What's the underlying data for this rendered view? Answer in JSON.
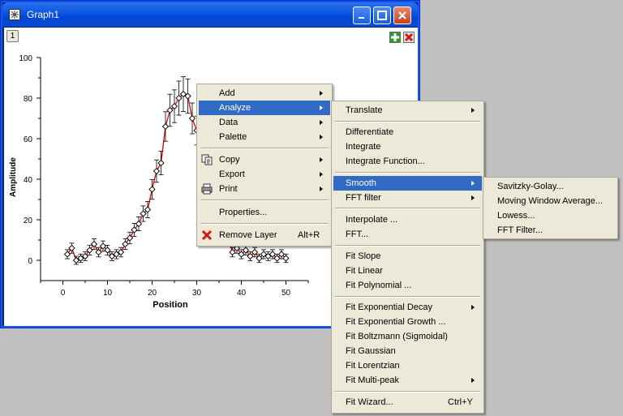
{
  "window": {
    "title": "Graph1",
    "layer_label": "1"
  },
  "plot": {
    "ylabel": "Amplitude",
    "xlabel": "Position",
    "xticks": [
      "0",
      "10",
      "20",
      "30",
      "40",
      "50"
    ],
    "yticks": [
      "0",
      "20",
      "40",
      "60",
      "80",
      "100"
    ]
  },
  "chart_data": {
    "type": "scatter",
    "xlabel": "Position",
    "ylabel": "Amplitude",
    "xlim": [
      -5,
      55
    ],
    "ylim": [
      -10,
      100
    ],
    "series": [
      {
        "points": [
          [
            1,
            3
          ],
          [
            2,
            6
          ],
          [
            3,
            0
          ],
          [
            4,
            1
          ],
          [
            5,
            2
          ],
          [
            6,
            5
          ],
          [
            7,
            8
          ],
          [
            8,
            4
          ],
          [
            9,
            7
          ],
          [
            10,
            5
          ],
          [
            11,
            2
          ],
          [
            12,
            3
          ],
          [
            13,
            4
          ],
          [
            14,
            8
          ],
          [
            15,
            11
          ],
          [
            16,
            15
          ],
          [
            17,
            18
          ],
          [
            18,
            23
          ],
          [
            19,
            25
          ],
          [
            20,
            35
          ],
          [
            21,
            44
          ],
          [
            22,
            48
          ],
          [
            23,
            66
          ],
          [
            24,
            74
          ],
          [
            25,
            76
          ],
          [
            26,
            80
          ],
          [
            27,
            82
          ],
          [
            28,
            81
          ],
          [
            29,
            70
          ],
          [
            30,
            64
          ],
          [
            31,
            58
          ],
          [
            38,
            4
          ],
          [
            39,
            6
          ],
          [
            40,
            3
          ],
          [
            41,
            5
          ],
          [
            42,
            2
          ],
          [
            43,
            4
          ],
          [
            44,
            1
          ],
          [
            45,
            3
          ],
          [
            46,
            2
          ],
          [
            47,
            3
          ],
          [
            48,
            1
          ],
          [
            49,
            3
          ],
          [
            50,
            1
          ]
        ]
      }
    ],
    "fit_color": "#e00000",
    "marker_color": "#000000"
  },
  "menu": {
    "items": [
      {
        "label": "Add"
      },
      {
        "label": "Analyze"
      },
      {
        "label": "Data"
      },
      {
        "label": "Palette"
      },
      {
        "label": "Copy"
      },
      {
        "label": "Export"
      },
      {
        "label": "Print"
      },
      {
        "label": "Properties..."
      },
      {
        "label": "Remove Layer",
        "shortcut": "Alt+R"
      }
    ]
  },
  "analyze_menu": {
    "items": [
      {
        "label": "Translate"
      },
      {
        "label": "Differentiate"
      },
      {
        "label": "Integrate"
      },
      {
        "label": "Integrate Function..."
      },
      {
        "label": "Smooth"
      },
      {
        "label": "FFT filter"
      },
      {
        "label": "Interpolate ..."
      },
      {
        "label": "FFT..."
      },
      {
        "label": "Fit Slope"
      },
      {
        "label": "Fit Linear"
      },
      {
        "label": "Fit Polynomial ..."
      },
      {
        "label": "Fit Exponential Decay"
      },
      {
        "label": "Fit Exponential Growth ..."
      },
      {
        "label": "Fit Boltzmann (Sigmoidal)"
      },
      {
        "label": "Fit Gaussian"
      },
      {
        "label": "Fit Lorentzian"
      },
      {
        "label": "Fit Multi-peak"
      },
      {
        "label": "Fit Wizard...",
        "shortcut": "Ctrl+Y"
      }
    ]
  },
  "smooth_menu": {
    "items": [
      {
        "label": "Savitzky-Golay..."
      },
      {
        "label": "Moving Window Average..."
      },
      {
        "label": "Lowess..."
      },
      {
        "label": "FFT Filter..."
      }
    ]
  },
  "colors": {
    "highlight": "#316ac5",
    "menu_bg": "#ece9d8",
    "titlebar": "#0a55e0"
  }
}
